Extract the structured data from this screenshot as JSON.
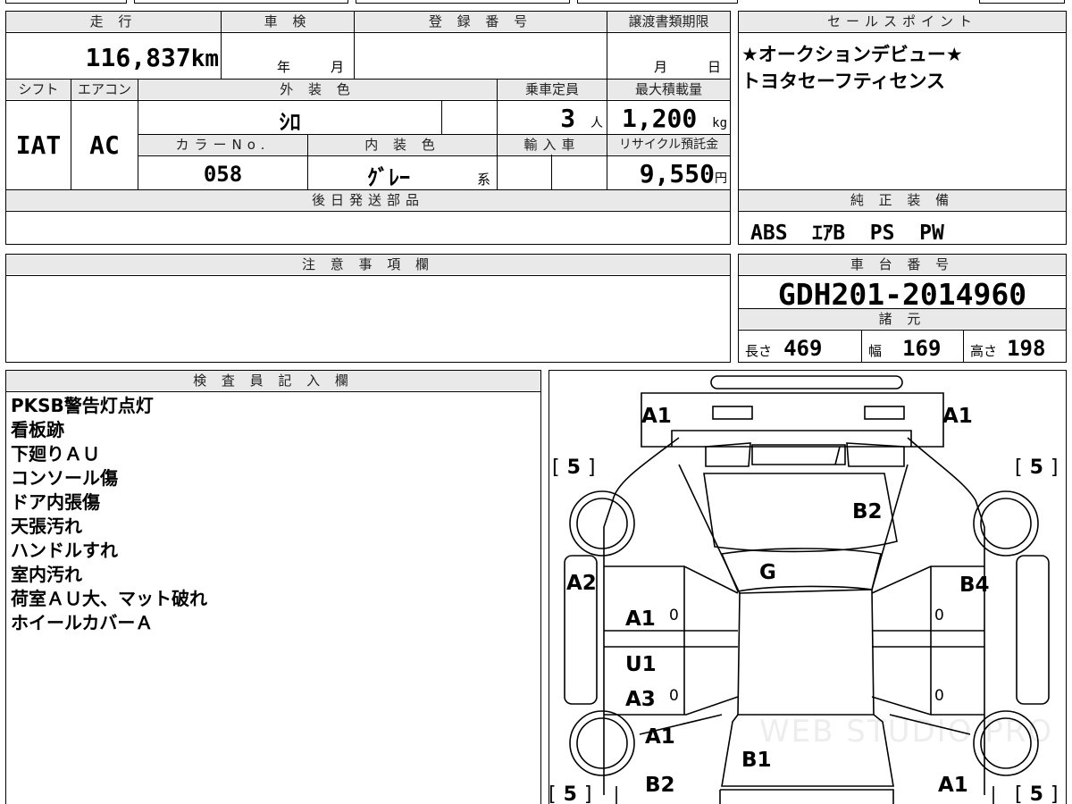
{
  "mileage": {
    "header": "走 行",
    "value": "116,837",
    "unit": "km"
  },
  "inspection": {
    "header": "車 検",
    "year_unit": "年",
    "month_unit": "月"
  },
  "registration": {
    "header": "登 録 番 号"
  },
  "transfer_deadline": {
    "header": "譲渡書類期限",
    "month_unit": "月",
    "day_unit": "日"
  },
  "sales_point": {
    "header": "セールスポイント",
    "lines": [
      "★オークションデビュー★",
      "トヨタセーフティセンス"
    ]
  },
  "shift": {
    "header": "シフト",
    "value": "IAT"
  },
  "aircon": {
    "header": "エアコン",
    "value": "AC"
  },
  "exterior_color": {
    "header": "外 装 色",
    "value": "ｼﾛ"
  },
  "capacity": {
    "header": "乗車定員",
    "value": "3",
    "unit": "人"
  },
  "max_load": {
    "header": "最大積載量",
    "value": "1,200",
    "unit": "kg"
  },
  "color_no": {
    "header": "カラーNo.",
    "value": "058"
  },
  "interior_color": {
    "header": "内 装 色",
    "value": "ｸﾞﾚｰ",
    "suffix": "系"
  },
  "import": {
    "header": "輸入車"
  },
  "recycle_fee": {
    "header": "リサイクル預託金",
    "value": "9,550",
    "unit": "円"
  },
  "later_parts": {
    "header": "後日発送部品"
  },
  "factory_equipment": {
    "header": "純 正 装 備",
    "value": "ABS  ｴｱB  PS  PW"
  },
  "notes": {
    "header": "注 意 事 項 欄"
  },
  "chassis_number": {
    "header": "車 台 番 号",
    "value": "GDH201-2014960"
  },
  "specs": {
    "header": "諸 元",
    "length_label": "長さ",
    "length": "469",
    "width_label": "幅",
    "width": "169",
    "height_label": "高さ",
    "height": "198"
  },
  "inspector_notes": {
    "header": "検 査 員 記 入 欄",
    "lines": [
      "PKSB警告灯点灯",
      "看板跡",
      "下廻りＡＵ",
      "コンソール傷",
      "ドア内張傷",
      "天張汚れ",
      "ハンドルすれ",
      "室内汚れ",
      "荷室ＡＵ大、マット破れ",
      "ホイールカバーＡ"
    ]
  },
  "diagram": {
    "bracket_l": "[",
    "bracket_r": "]",
    "tread": "5",
    "zero": "0",
    "labels": {
      "front_left": "A1",
      "front_right": "A1",
      "hood": "B2",
      "roof": "G",
      "side_left": "A2",
      "door_right": "B4",
      "door_left_front": "A1",
      "door_left_rear_u": "U1",
      "door_left_rear_a": "A3",
      "rear_left_a": "A1",
      "rear_left_b": "B2",
      "tailgate": "B1",
      "rear_right": "A1"
    },
    "watermark": "WEB STUDIO PRO"
  }
}
